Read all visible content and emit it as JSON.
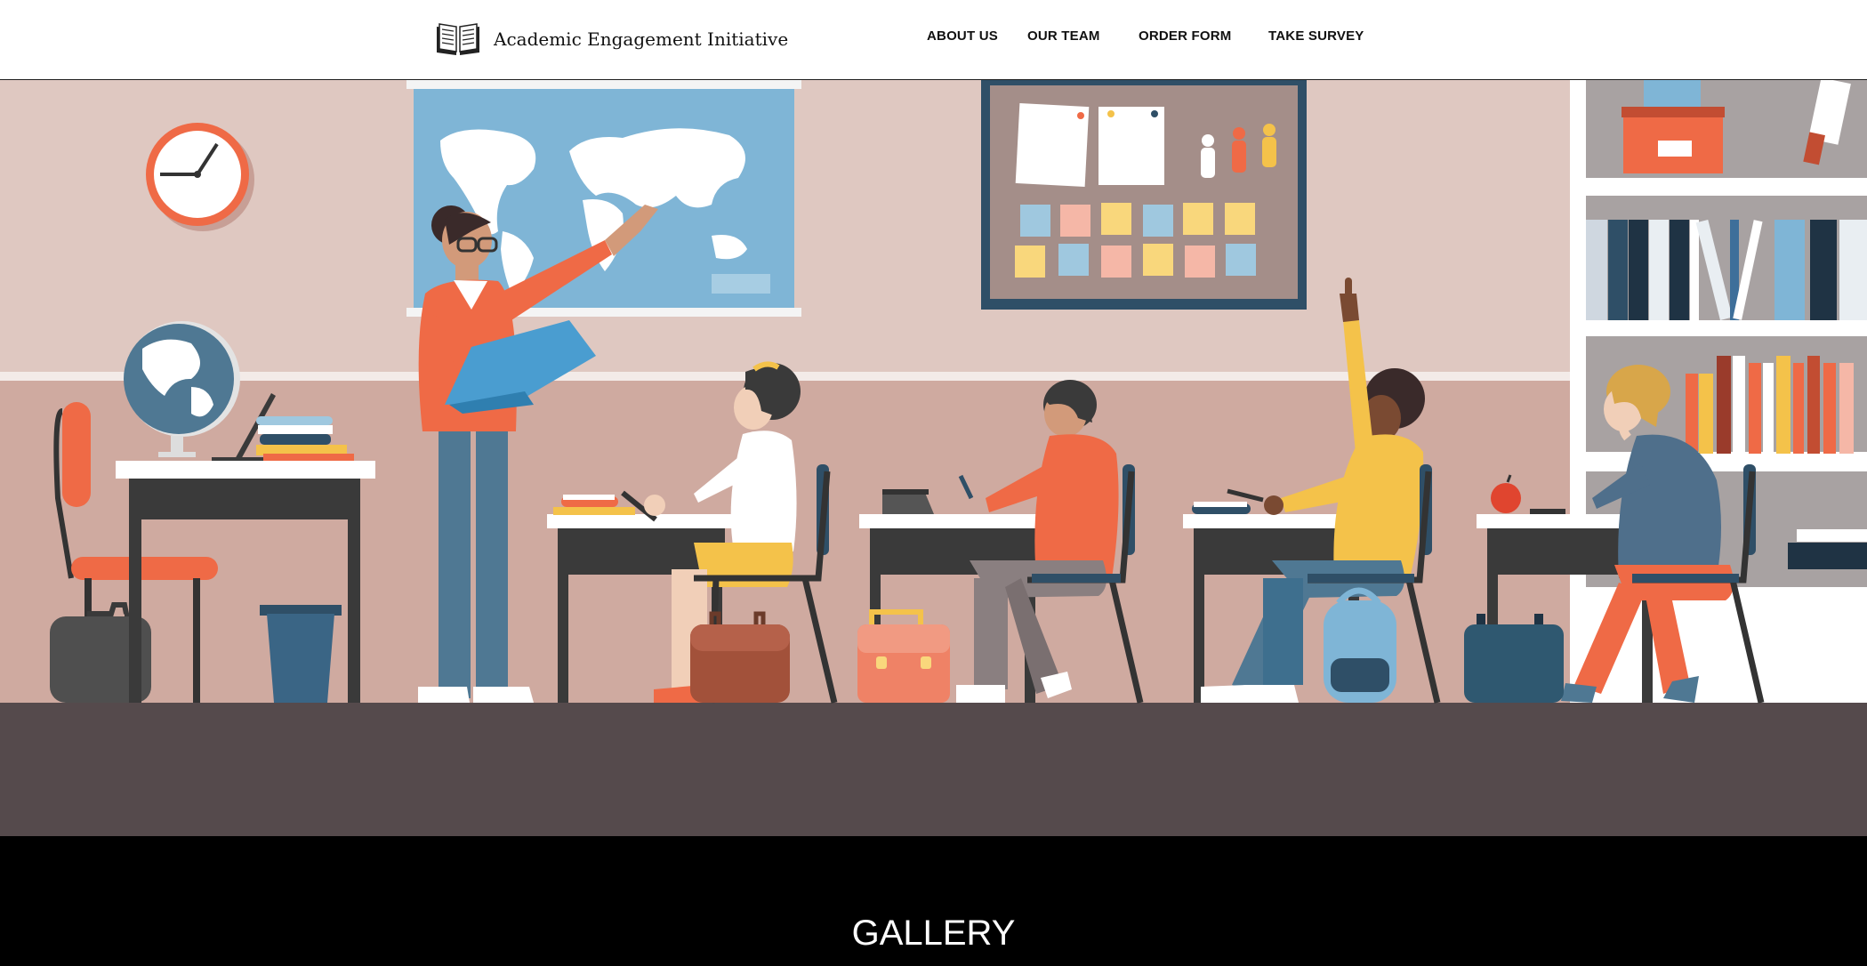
{
  "header": {
    "brand_name": "Academic Engagement Initiative",
    "logo_icon": "open-book-icon"
  },
  "nav": {
    "items": [
      {
        "label": "ABOUT US"
      },
      {
        "label": "OUR TEAM"
      },
      {
        "label": "ORDER FORM"
      },
      {
        "label": "TAKE SURVEY"
      }
    ]
  },
  "hero": {
    "illustration": "classroom-illustration"
  },
  "gallery": {
    "title": "GALLERY"
  },
  "colors": {
    "header_bg": "#ffffff",
    "wall_top": "#dfc8c1",
    "wall_bottom": "#cfaaa0",
    "floor": "#554a4c",
    "footer_bg": "#000000",
    "accent_orange": "#ef6a46",
    "accent_blue": "#7fb5d6",
    "accent_yellow": "#f4c24a"
  }
}
